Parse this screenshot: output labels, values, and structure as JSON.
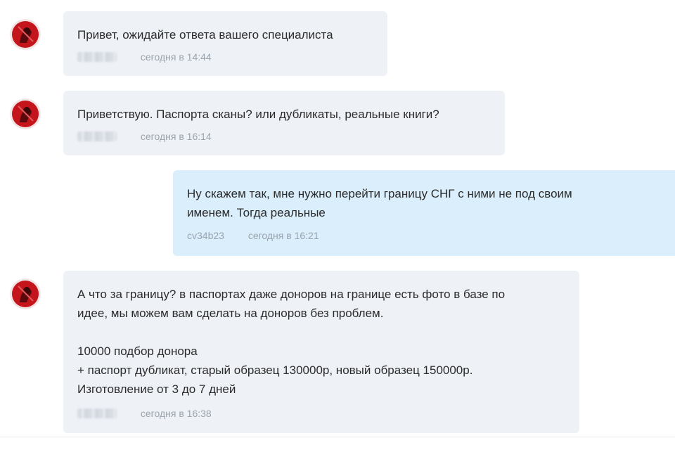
{
  "messages": [
    {
      "text": "Привет, ожидайте ответа вашего специалиста",
      "time": "сегодня в 14:44"
    },
    {
      "text": "Приветствую. Паспорта сканы? или дубликаты, реальные книги?",
      "time": "сегодня в 16:14"
    },
    {
      "text": "Ну скажем так, мне нужно перейти границу СНГ с ними не под своим\nименем. Тогда реальные",
      "sender": "cv34b23",
      "time": "сегодня в 16:21"
    },
    {
      "text": "А что за границу? в паспортах даже доноров на границе есть фото в базе по\nидее, мы можем вам сделать на доноров без проблем.\n\n10000 подбор донора\n+ паспорт дубликат, старый образец 130000р, новый образец 150000р.\nИзготовление от 3 до 7 дней",
      "time": "сегодня в 16:38"
    }
  ],
  "colors": {
    "incoming_bubble": "#eef1f6",
    "outgoing_bubble": "#dbeefc",
    "meta_text": "#9aa3ad",
    "avatar_red": "#c4141c"
  },
  "icons": {
    "avatar": "red-circle-avatar-icon"
  }
}
